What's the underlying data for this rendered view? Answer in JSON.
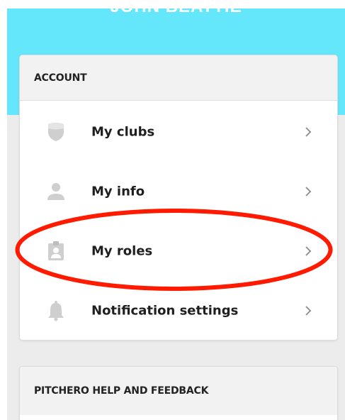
{
  "profile": {
    "name": "JOHN BEATTIE"
  },
  "account": {
    "header": "ACCOUNT",
    "items": [
      {
        "label": "My clubs",
        "icon": "shield-icon"
      },
      {
        "label": "My info",
        "icon": "person-icon"
      },
      {
        "label": "My roles",
        "icon": "id-badge-icon"
      },
      {
        "label": "Notification settings",
        "icon": "bell-icon"
      }
    ]
  },
  "help": {
    "header": "PITCHERO HELP AND FEEDBACK"
  },
  "colors": {
    "header_band": "#64e6fb",
    "annotation_red": "#ff1a00",
    "icon_gray": "#cfcfcf"
  }
}
